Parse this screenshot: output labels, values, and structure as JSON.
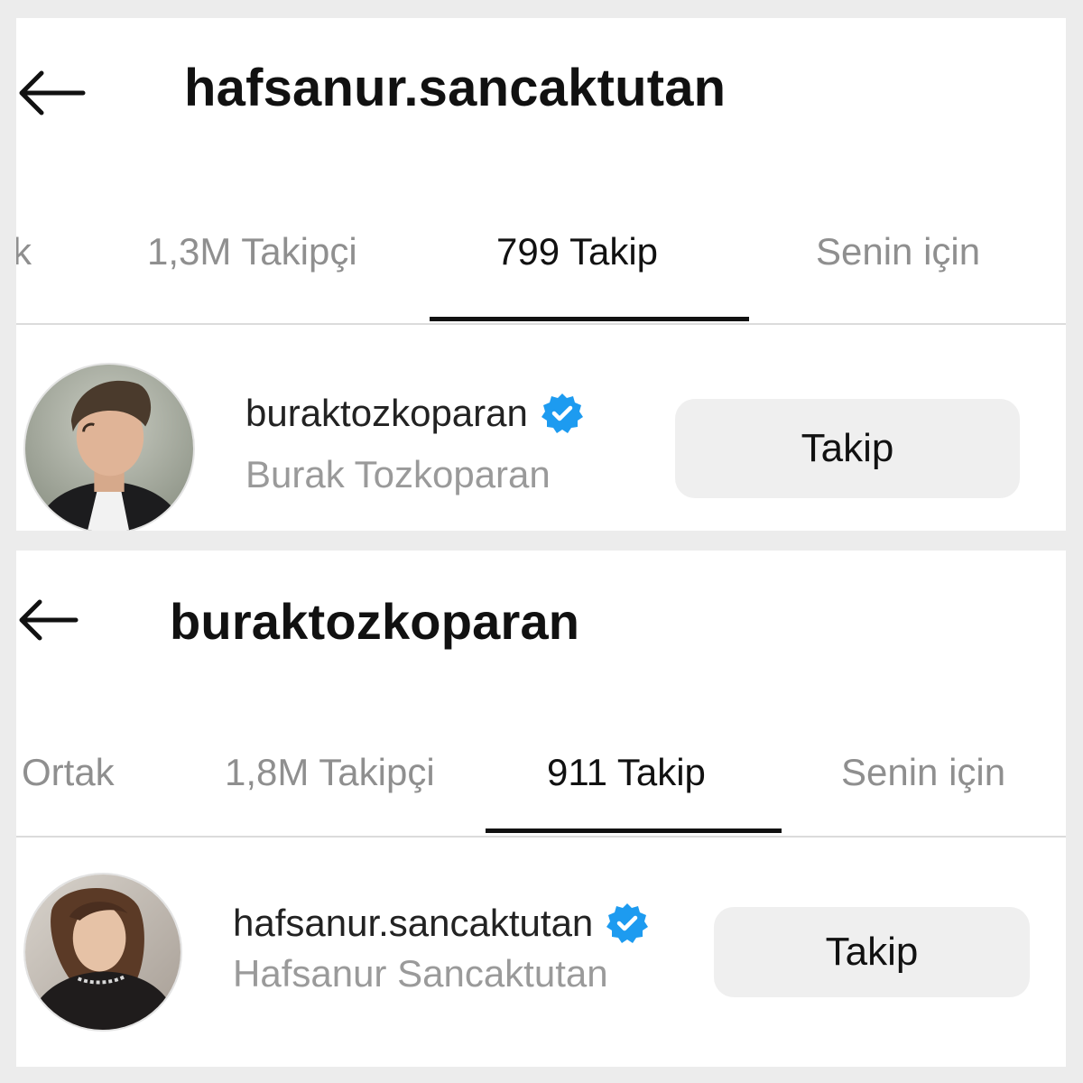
{
  "panels": [
    {
      "title": "hafsanur.sancaktutan",
      "tabs": [
        {
          "label": "k",
          "active": false
        },
        {
          "label": "1,3M Takipçi",
          "active": false
        },
        {
          "label": "799 Takip",
          "active": true
        },
        {
          "label": "Senin için",
          "active": false
        }
      ],
      "row": {
        "username": "buraktozkoparan",
        "fullname": "Burak Tozkoparan",
        "verified": true,
        "button_label": "Takip"
      }
    },
    {
      "title": "buraktozkoparan",
      "tabs": [
        {
          "label": "Ortak",
          "active": false
        },
        {
          "label": "1,8M Takipçi",
          "active": false
        },
        {
          "label": "911 Takip",
          "active": true
        },
        {
          "label": "Senin için",
          "active": false
        }
      ],
      "row": {
        "username": "hafsanur.sancaktutan",
        "fullname": "Hafsanur Sancaktutan",
        "verified": true,
        "button_label": "Takip"
      }
    }
  ],
  "icons": {
    "back": "arrow-left-icon",
    "verified": "verified-badge-icon"
  },
  "colors": {
    "verified_blue": "#1d9bf0",
    "active_tab": "#111111",
    "inactive_tab": "#8f8f8f",
    "button_bg": "#efefef",
    "fullname": "#9a9a9a"
  }
}
